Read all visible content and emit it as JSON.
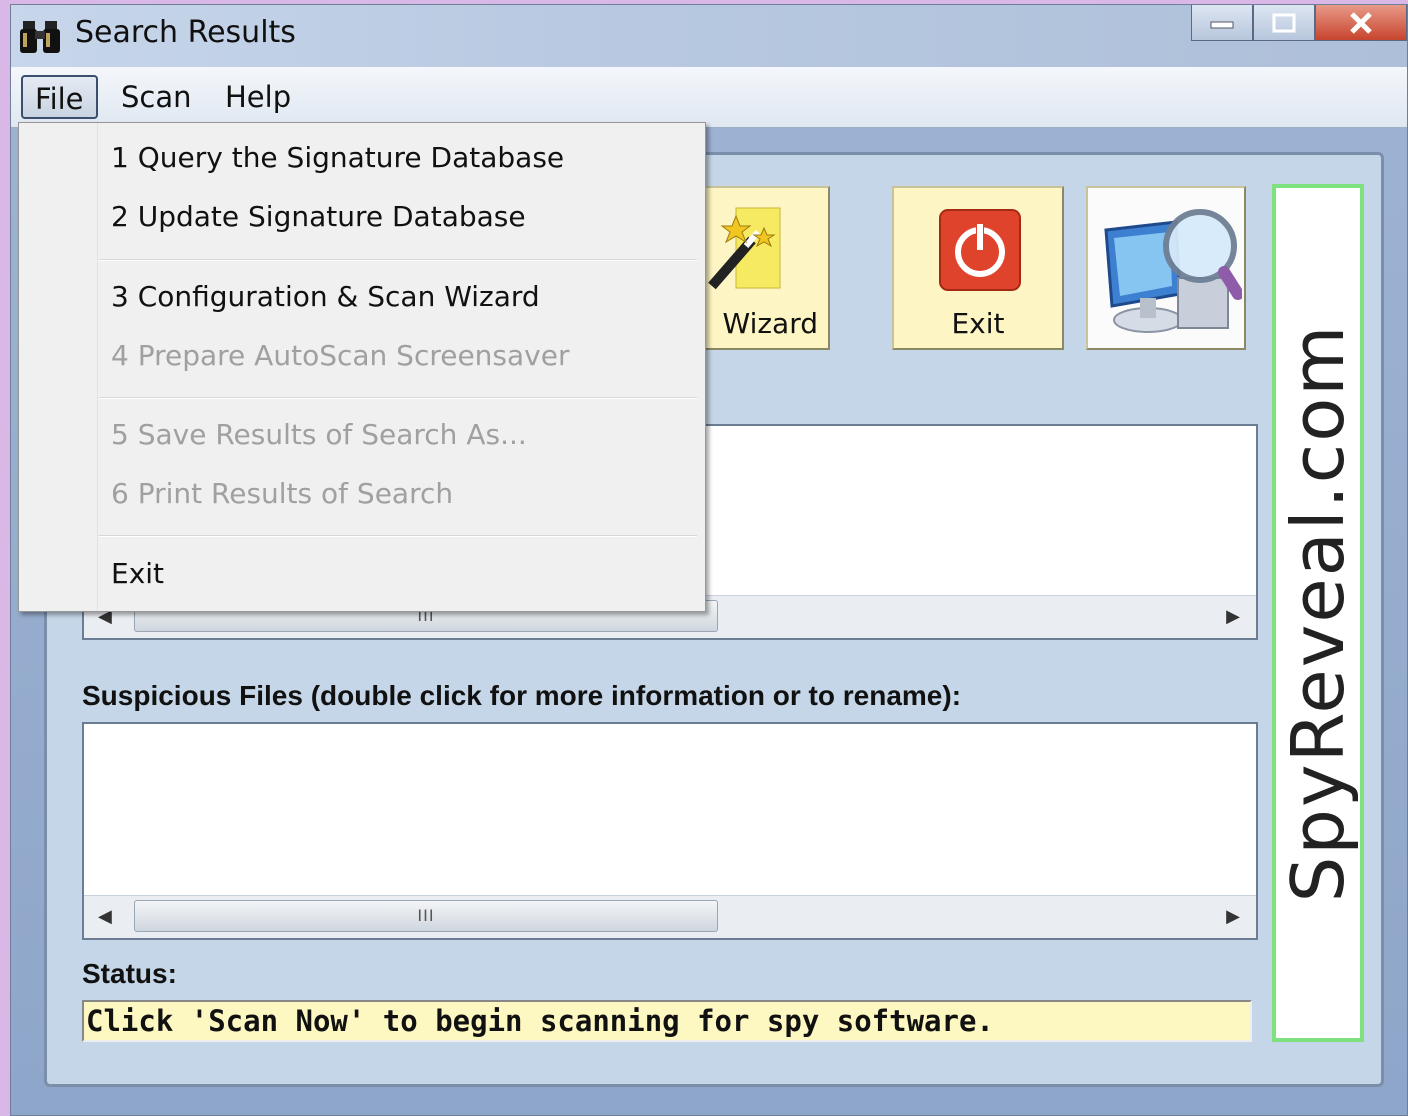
{
  "window": {
    "title": "Search Results"
  },
  "menubar": {
    "items": [
      "File",
      "Scan",
      "Help"
    ]
  },
  "file_menu": {
    "items": [
      {
        "label": "1 Query the Signature Database",
        "enabled": true
      },
      {
        "label": "2 Update Signature Database",
        "enabled": true
      },
      {
        "label": "3 Configuration & Scan Wizard",
        "enabled": true
      },
      {
        "label": "4 Prepare AutoScan Screensaver",
        "enabled": false
      },
      {
        "label": "5 Save Results of Search As...",
        "enabled": false
      },
      {
        "label": "6 Print Results of Search",
        "enabled": false
      },
      {
        "label": "Exit",
        "enabled": true
      }
    ]
  },
  "toolbar": {
    "wizard_label": "Wizard",
    "exit_label": "Exit"
  },
  "suspicious": {
    "label": "Suspicious Files (double click for more information or to rename):"
  },
  "status": {
    "label": "Status:",
    "message": "Click 'Scan Now' to begin scanning for spy software."
  },
  "brand": {
    "text": "SpyReveal.com"
  },
  "icons": {
    "app": "binoculars-icon",
    "wizard": "magic-wand-icon",
    "exit": "power-icon",
    "scan": "computer-magnifier-icon"
  },
  "colors": {
    "status_bg": "#fdf8c2",
    "toolbar_btn_bg": "#fdf5c3",
    "brand_border": "#7de27d"
  }
}
